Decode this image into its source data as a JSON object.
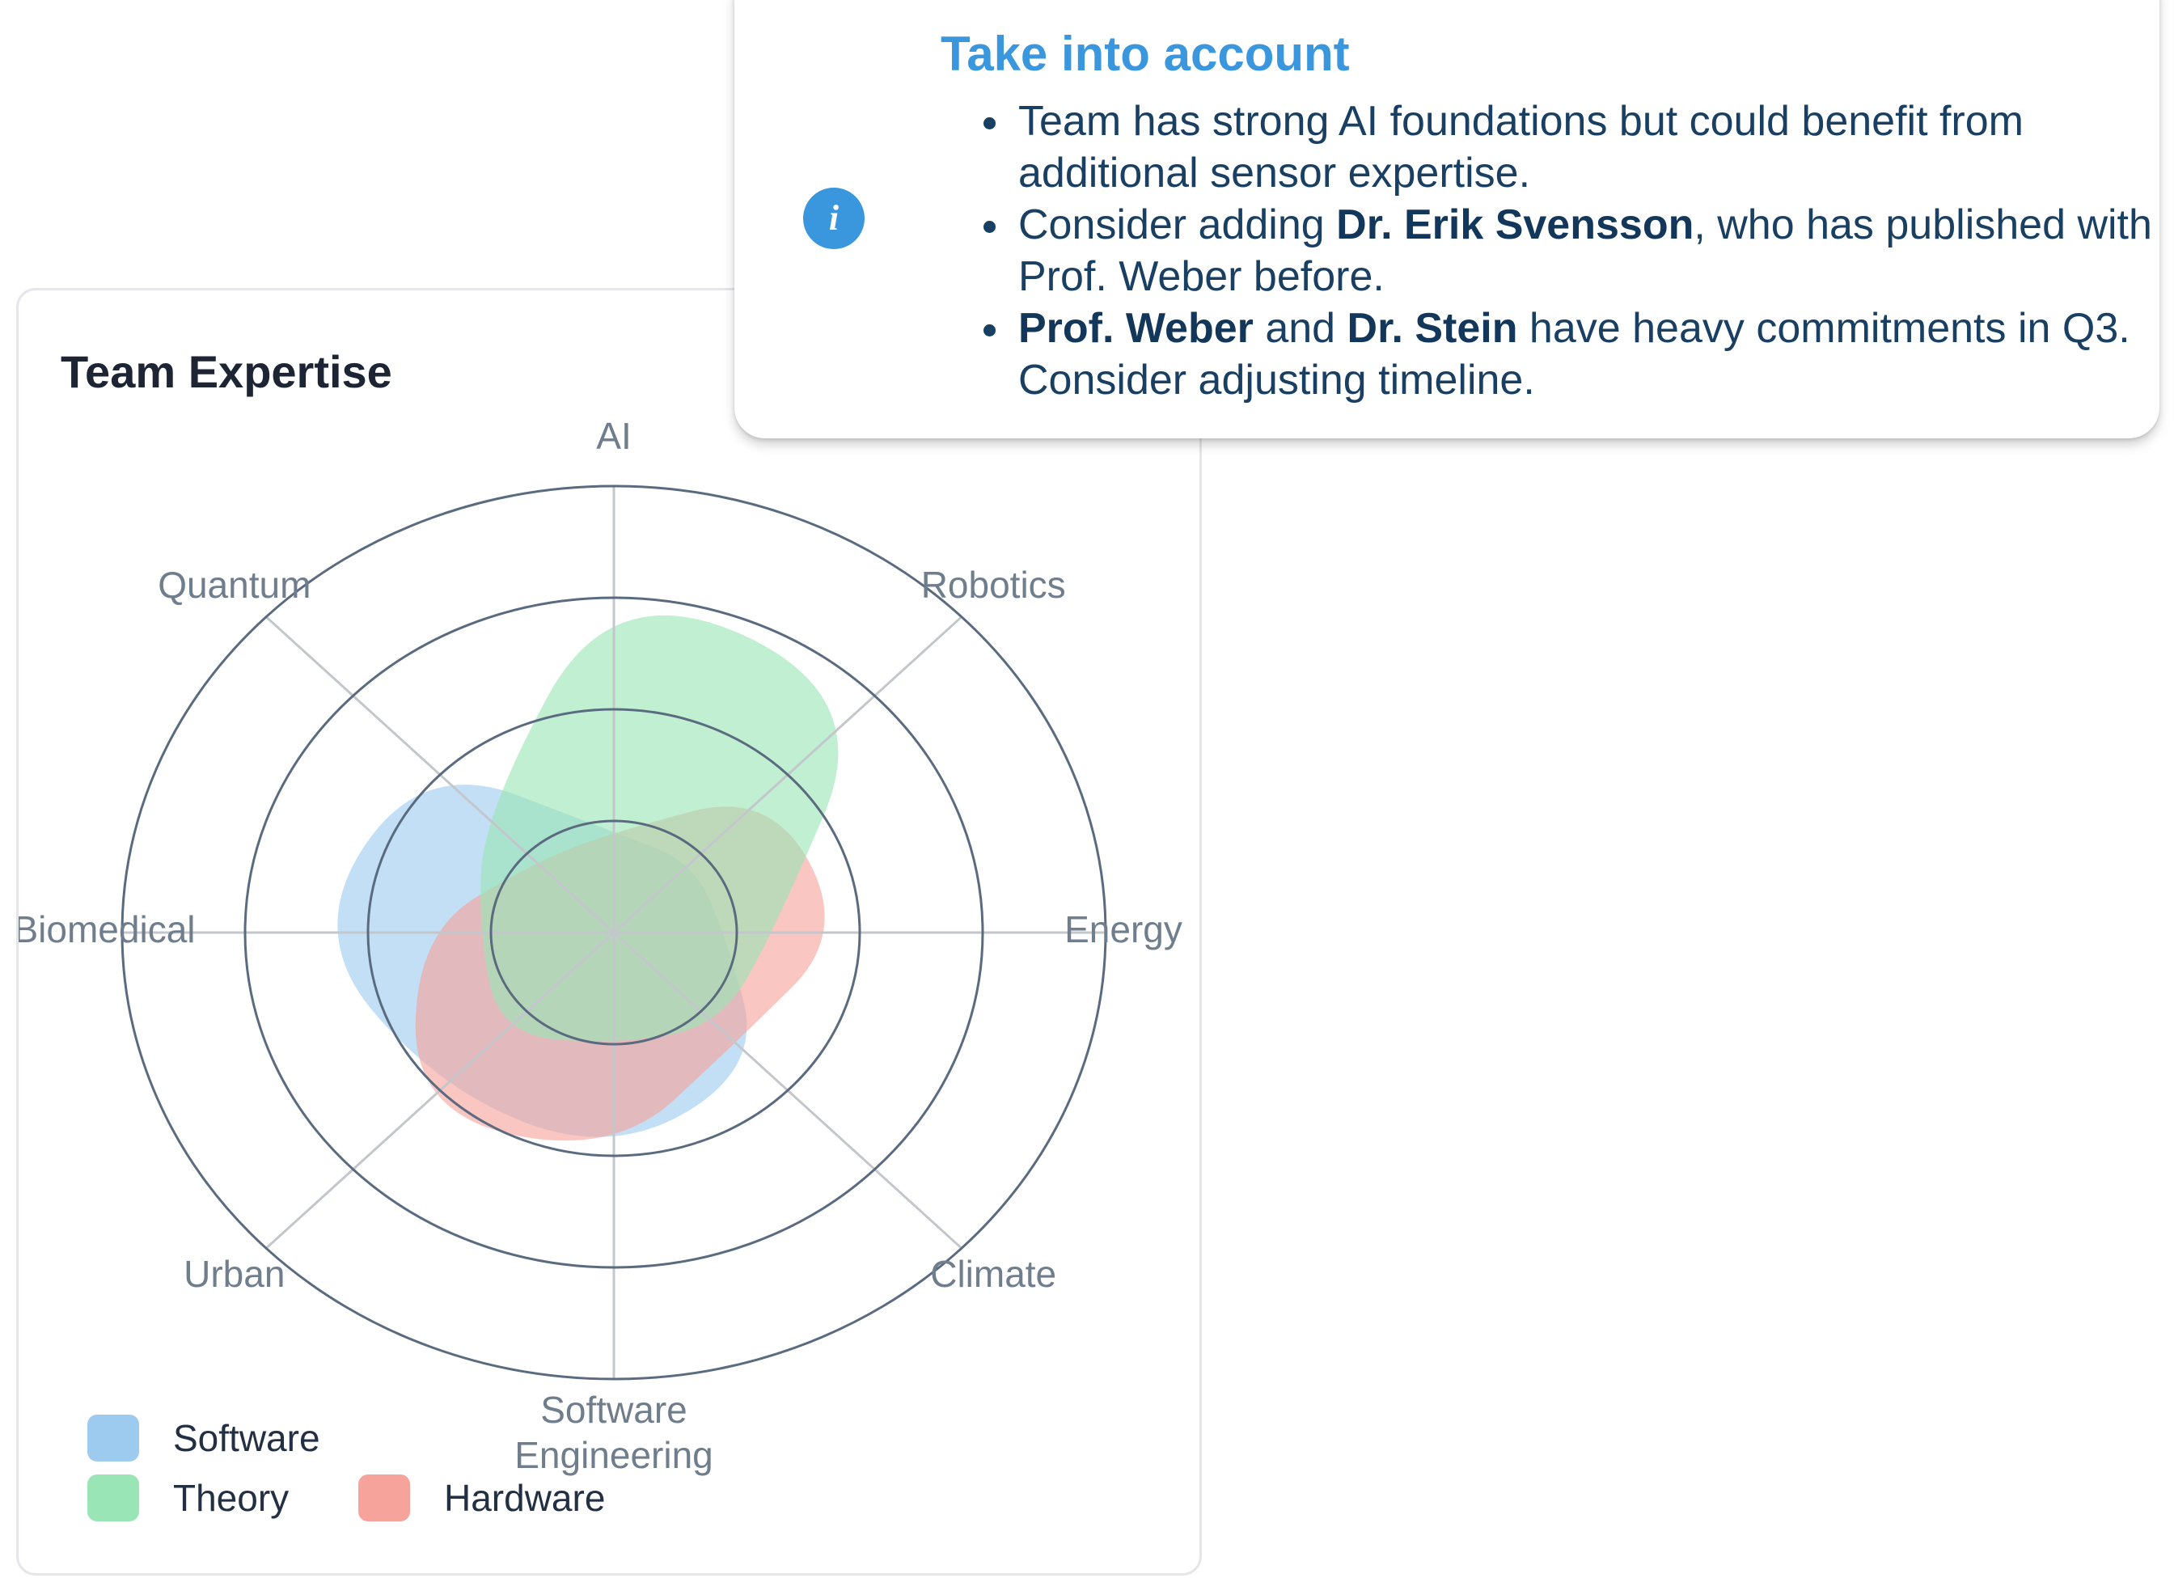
{
  "chart_card": {
    "title": "Team Expertise"
  },
  "chart_data": {
    "type": "radar",
    "title": "Team Expertise",
    "axes": [
      "AI",
      "Robotics",
      "Energy",
      "Climate",
      "Software Engineering",
      "Urban",
      "Biomedical",
      "Quantum"
    ],
    "axis_label_lines": [
      [
        "AI"
      ],
      [
        "Robotics"
      ],
      [
        "Energy"
      ],
      [
        "Climate"
      ],
      [
        "Software",
        "Engineering"
      ],
      [
        "Urban"
      ],
      [
        "Biomedical"
      ],
      [
        "Quantum"
      ]
    ],
    "rlim": [
      0,
      4
    ],
    "rings": [
      1,
      2,
      3,
      4
    ],
    "grid": true,
    "series": [
      {
        "name": "Software",
        "color": "#9ccbef",
        "values": [
          0.9,
          0.9,
          0.9,
          1.7,
          2.0,
          2.0,
          2.5,
          2.2
        ]
      },
      {
        "name": "Hardware",
        "color": "#f5a39b",
        "values": [
          0.9,
          1.8,
          1.9,
          1.4,
          2.0,
          2.3,
          1.6,
          0.9
        ]
      },
      {
        "name": "Theory",
        "color": "#99e5b5",
        "values": [
          3.2,
          3.0,
          1.3,
          1.2,
          1.0,
          1.3,
          1.1,
          1.5
        ]
      }
    ],
    "legend_position": "bottom-left"
  },
  "legend": {
    "items": [
      {
        "label": "Software",
        "color": "#9ccbef"
      },
      {
        "label": "Theory",
        "color": "#99e5b5"
      },
      {
        "label": "Hardware",
        "color": "#f5a39b"
      }
    ]
  },
  "info_popover": {
    "icon": "info-icon",
    "icon_glyph": "i",
    "title": "Take into account",
    "items": [
      {
        "parts": [
          {
            "text": "Team has strong AI foundations but could benefit from additional sensor expertise.",
            "bold": false
          }
        ]
      },
      {
        "parts": [
          {
            "text": "Consider adding ",
            "bold": false
          },
          {
            "text": "Dr. Erik Svensson",
            "bold": true
          },
          {
            "text": ", who has published with Prof. Weber before.",
            "bold": false
          }
        ]
      },
      {
        "parts": [
          {
            "text": "Prof. Weber",
            "bold": true
          },
          {
            "text": " and ",
            "bold": false
          },
          {
            "text": "Dr. Stein",
            "bold": true
          },
          {
            "text": " have heavy commitments in Q3. Consider adjusting timeline.",
            "bold": false
          }
        ]
      }
    ]
  }
}
